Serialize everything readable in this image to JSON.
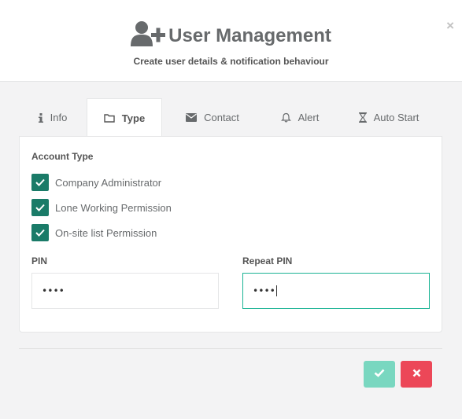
{
  "header": {
    "title": "User Management",
    "subtitle": "Create user details & notification behaviour",
    "close_label": "×",
    "icon": "user-plus-icon"
  },
  "tabs": [
    {
      "label": "Info",
      "icon": "info-icon",
      "active": false
    },
    {
      "label": "Type",
      "icon": "folder-icon",
      "active": true
    },
    {
      "label": "Contact",
      "icon": "envelope-icon",
      "active": false
    },
    {
      "label": "Alert",
      "icon": "bell-icon",
      "active": false
    },
    {
      "label": "Auto Start",
      "icon": "hourglass-icon",
      "active": false
    }
  ],
  "account_type": {
    "label": "Account Type",
    "options": [
      {
        "label": "Company Administrator",
        "checked": true
      },
      {
        "label": "Lone Working Permission",
        "checked": true
      },
      {
        "label": "On-site list Permission",
        "checked": true
      }
    ]
  },
  "pin": {
    "label": "PIN",
    "value": "••••"
  },
  "repeat_pin": {
    "label": "Repeat PIN",
    "value": "••••"
  },
  "actions": {
    "confirm_icon": "check-icon",
    "cancel_icon": "times-icon"
  },
  "colors": {
    "checkbox": "#1a7b68",
    "focus_border": "#1ab394",
    "confirm_button": "#79d7c0",
    "cancel_button": "#ec4758",
    "active_tab_underline": "#c0392b"
  }
}
